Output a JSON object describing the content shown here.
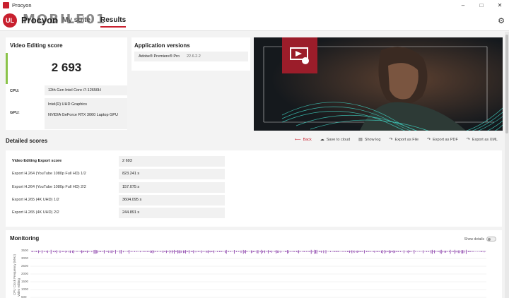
{
  "window": {
    "title": "Procyon"
  },
  "header": {
    "logo_text": "UL",
    "brand": "Procyon",
    "watermark": "MOBILE01",
    "tabs": [
      {
        "label": "My suite"
      },
      {
        "label": "Results"
      }
    ],
    "active_tab": "Results"
  },
  "score_card": {
    "title": "Video Editing score",
    "score": "2 693",
    "accent_color": "#8bc34a",
    "cpu_label": "CPU:",
    "cpu_value": "12th Gen Intel Core i7-12650H",
    "gpu_label": "GPU:",
    "gpu_values": [
      "Intel(R) UHD Graphics",
      "NVIDIA GeForce RTX 3060 Laptop GPU"
    ]
  },
  "versions": {
    "title": "Application versions",
    "rows": [
      {
        "name": "Adobe® Premiere® Pro",
        "version": "22.6.2.2"
      }
    ]
  },
  "detailed": {
    "title": "Detailed scores",
    "actions": {
      "back": "Back",
      "save_cloud": "Save to cloud",
      "show_log": "Show log",
      "export_file": "Export as File",
      "export_pdf": "Export as PDF",
      "export_xml": "Export as XML"
    },
    "rows": [
      {
        "label": "Video Editing Export score",
        "value": "2 693"
      },
      {
        "label": "Export H.264 (YouTube 1080p Full HD) 1/2",
        "value": "823.241 s"
      },
      {
        "label": "Export H.264 (YouTube 1080p Full HD) 2/2",
        "value": "157.075 s"
      },
      {
        "label": "Export H.265 (4K UHD) 1/2",
        "value": "3604.095 s"
      },
      {
        "label": "Export H.265 (4K UHD) 2/2",
        "value": "244.891 s"
      }
    ]
  },
  "monitoring": {
    "title": "Monitoring",
    "show_details_label": "Show details",
    "show_details_on": false,
    "y_axis_label": "CPU Clock Frequency (MHz)",
    "series_label": "Video editing",
    "y_ticks": [
      "3500",
      "3000",
      "2500",
      "2000",
      "1500",
      "1000",
      "500"
    ],
    "series_color": "#8e44ad",
    "series_level_mhz": 3450
  },
  "colors": {
    "brand_red": "#c8202f",
    "hero_badge": "#9b1d2a"
  }
}
